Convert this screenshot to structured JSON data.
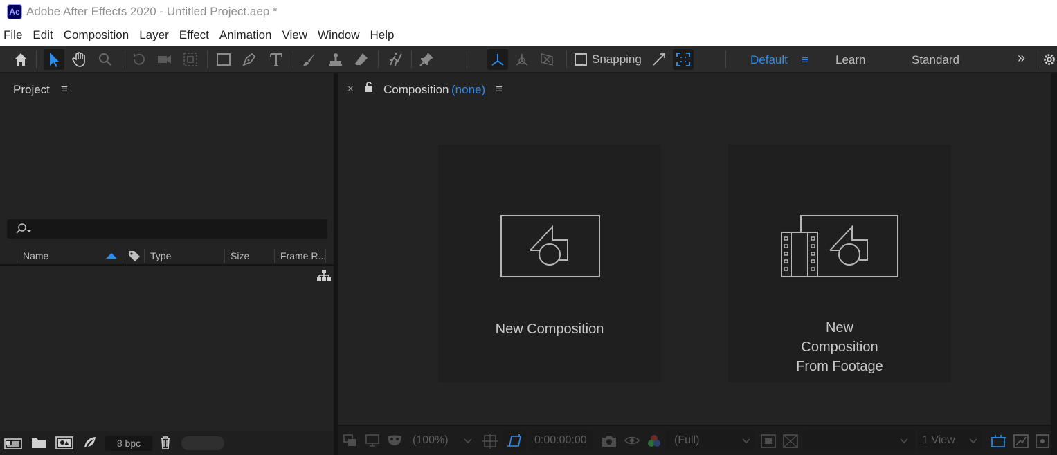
{
  "window": {
    "title": "Adobe After Effects 2020 - Untitled Project.aep *",
    "logo": "Ae"
  },
  "menu": [
    "File",
    "Edit",
    "Composition",
    "Layer",
    "Effect",
    "Animation",
    "View",
    "Window",
    "Help"
  ],
  "toolbar": {
    "snapping_label": "Snapping",
    "workspaces": [
      {
        "label": "Default",
        "active": true
      },
      {
        "label": "Learn",
        "active": false
      },
      {
        "label": "Standard",
        "active": false
      }
    ],
    "overflow": "»"
  },
  "project_panel": {
    "title": "Project",
    "menu_icon": "≡",
    "columns": [
      "Name",
      "Type",
      "Size",
      "Frame R..."
    ],
    "bpc": "8 bpc"
  },
  "composition_panel": {
    "close": "×",
    "title": "Composition",
    "subtitle": "(none)",
    "menu_icon": "≡",
    "cards": {
      "new": "New Composition",
      "from_footage": [
        "New",
        "Composition",
        "From Footage"
      ]
    },
    "footer": {
      "zoom": "(100%)",
      "timecode": "0:00:00:00",
      "resolution": "(Full)",
      "views": "1 View"
    }
  },
  "colors": {
    "accent": "#2d8ceb",
    "panel": "#232323",
    "dark": "#1d1d1d"
  }
}
